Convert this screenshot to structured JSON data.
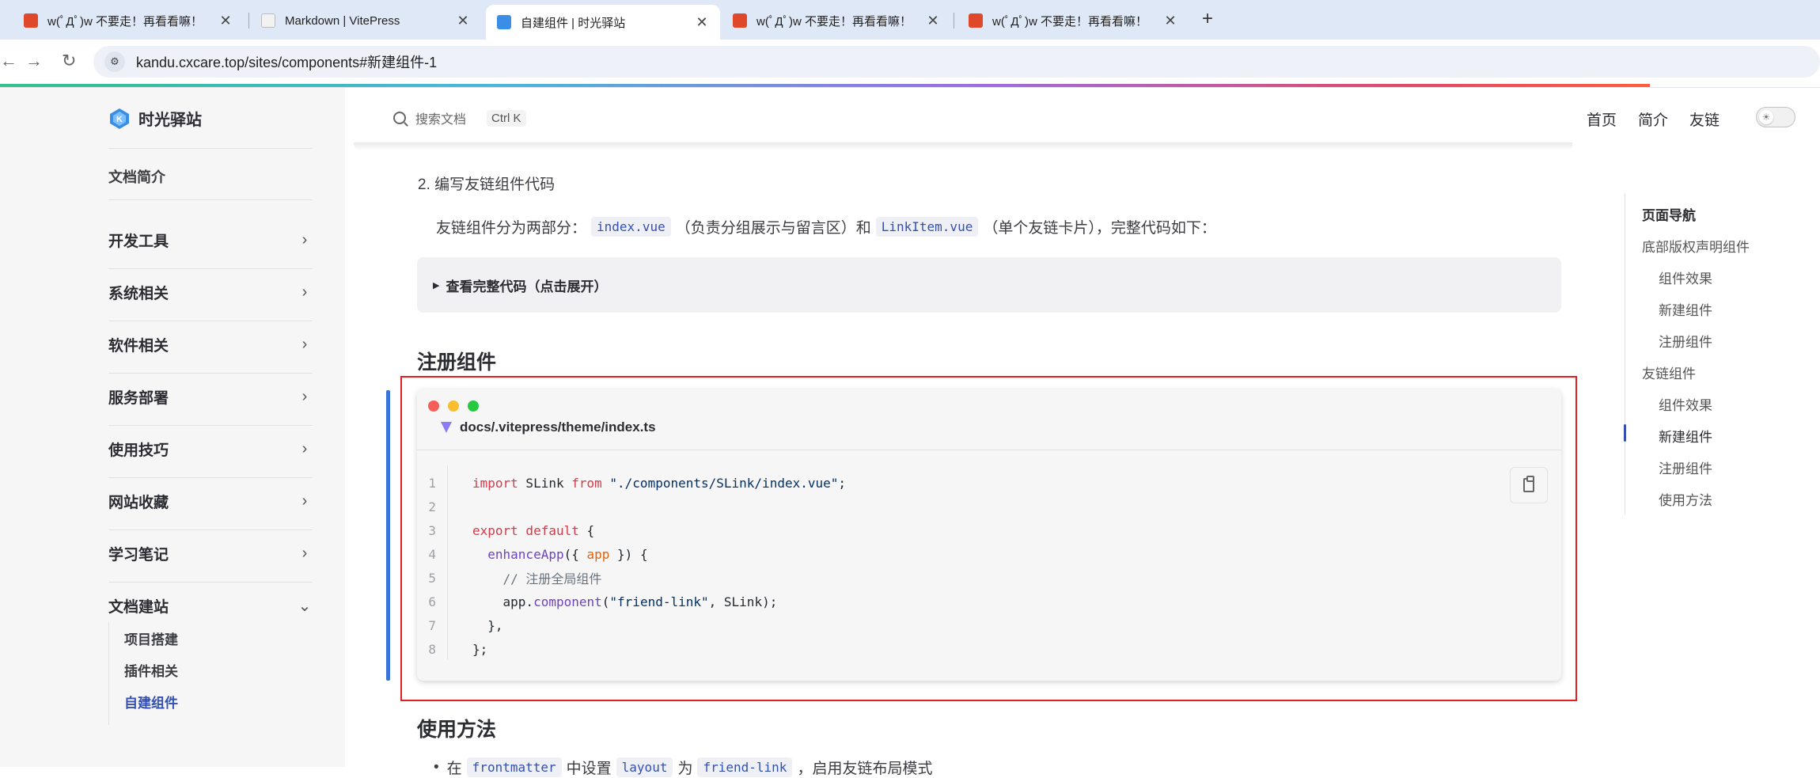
{
  "browser": {
    "tabs": [
      {
        "title": "w(ﾟДﾟ)w 不要走！再看看嘛！",
        "active": false
      },
      {
        "title": "Markdown | VitePress",
        "active": false
      },
      {
        "title": "自建组件 | 时光驿站",
        "active": true
      },
      {
        "title": "w(ﾟДﾟ)w 不要走！再看看嘛！",
        "active": false
      },
      {
        "title": "w(ﾟДﾟ)w 不要走！再看看嘛！",
        "active": false
      }
    ],
    "close_glyph": "✕",
    "new_tab_glyph": "+",
    "url": "kandu.cxcare.top/sites/components#新建组件-1"
  },
  "site": {
    "name": "时光驿站",
    "search_placeholder": "搜索文档",
    "search_shortcut": "Ctrl K",
    "nav": [
      "首页",
      "简介",
      "友链"
    ]
  },
  "sidebar": {
    "intro": "文档简介",
    "groups": [
      "开发工具",
      "系统相关",
      "软件相关",
      "服务部署",
      "使用技巧",
      "网站收藏",
      "学习笔记",
      "文档建站"
    ],
    "sub_items": [
      "项目搭建",
      "插件相关",
      "自建组件"
    ],
    "active_sub": "自建组件"
  },
  "main": {
    "step": "2. 编写友链组件代码",
    "para_prefix": "友链组件分为两部分：",
    "code1": "index.vue",
    "para_mid1": "（负责分组展示与留言区）和",
    "code2": "LinkItem.vue",
    "para_mid2": "（单个友链卡片），完整代码如下：",
    "details_label": "查看完整代码（点击展开）",
    "h2_register": "注册组件",
    "h2_usage": "使用方法",
    "usage_prefix": "在",
    "usage_code1": "frontmatter",
    "usage_mid1": "中设置",
    "usage_code2": "layout",
    "usage_mid2": "为",
    "usage_code3": "friend-link",
    "usage_suffix": "，启用友链布局模式"
  },
  "codeblock": {
    "filename": "docs/.vitepress/theme/index.ts",
    "line_numbers": [
      "1",
      "2",
      "3",
      "4",
      "5",
      "6",
      "7",
      "8"
    ],
    "l1_import": "import",
    "l1_name": " SLink ",
    "l1_from": "from",
    "l1_path": " \"./components/SLink/index.vue\"",
    "l1_end": ";",
    "l3_export": "export default",
    "l3_brace": " {",
    "l4_fn": "  enhanceApp",
    "l4_open": "({ ",
    "l4_param": "app",
    "l4_close": " }) {",
    "l5_comment": "    // 注册全局组件",
    "l6_obj": "    app.",
    "l6_method": "component",
    "l6_open": "(",
    "l6_arg": "\"friend-link\"",
    "l6_rest": ", SLink);",
    "l7": "  },",
    "l8": "};"
  },
  "outline": {
    "title": "页面导航",
    "items": [
      {
        "label": "底部版权声明组件",
        "level": 1
      },
      {
        "label": "组件效果",
        "level": 2
      },
      {
        "label": "新建组件",
        "level": 2
      },
      {
        "label": "注册组件",
        "level": 2
      },
      {
        "label": "友链组件",
        "level": 1
      },
      {
        "label": "组件效果",
        "level": 2
      },
      {
        "label": "新建组件",
        "level": 2,
        "active": true
      },
      {
        "label": "注册组件",
        "level": 2
      },
      {
        "label": "使用方法",
        "level": 2
      }
    ]
  },
  "colors": {
    "accent": "#3451b2",
    "highlight_frame": "#e02020",
    "mac_red": "#f65f57",
    "mac_yellow": "#f9be2e",
    "mac_green": "#28c840"
  }
}
